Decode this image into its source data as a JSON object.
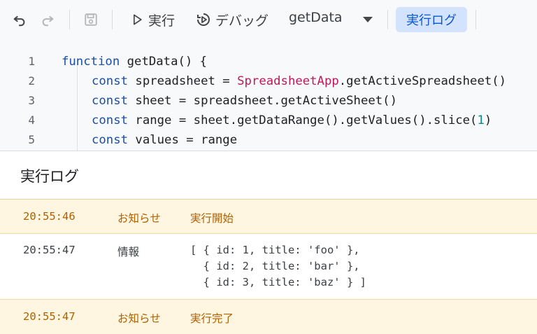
{
  "toolbar": {
    "run_label": "実行",
    "debug_label": "デバッグ",
    "function_select": "getData",
    "log_button": "実行ログ"
  },
  "editor": {
    "lines": [
      {
        "num": "1",
        "parts": [
          {
            "t": "function",
            "c": "kw"
          },
          {
            "t": " getData() {",
            "c": ""
          }
        ]
      },
      {
        "num": "2",
        "parts": [
          {
            "t": "const",
            "c": "kw"
          },
          {
            "t": " spreadsheet = ",
            "c": ""
          },
          {
            "t": "SpreadsheetApp",
            "c": "cls"
          },
          {
            "t": ".getActiveSpreadsheet()",
            "c": ""
          }
        ]
      },
      {
        "num": "3",
        "parts": [
          {
            "t": "const",
            "c": "kw"
          },
          {
            "t": " sheet = spreadsheet.getActiveSheet()",
            "c": ""
          }
        ]
      },
      {
        "num": "4",
        "parts": [
          {
            "t": "const",
            "c": "kw"
          },
          {
            "t": " range = sheet.getDataRange().getValues().slice(",
            "c": ""
          },
          {
            "t": "1",
            "c": "num"
          },
          {
            "t": ")",
            "c": ""
          }
        ]
      },
      {
        "num": "5",
        "parts": [
          {
            "t": "const",
            "c": "kw"
          },
          {
            "t": " values = range",
            "c": ""
          }
        ]
      }
    ]
  },
  "log": {
    "title": "実行ログ",
    "entries": [
      {
        "time": "20:55:46",
        "level": "お知らせ",
        "message": "実行開始"
      },
      {
        "time": "20:55:47",
        "level": "情報",
        "message": "[ { id: 1, title: 'foo' },\n  { id: 2, title: 'bar' },\n  { id: 3, title: 'baz' } ]"
      },
      {
        "time": "20:55:47",
        "level": "お知らせ",
        "message": "実行完了"
      }
    ]
  },
  "colors": {
    "accent": "#0b57d0",
    "notice_bg": "#fef6e0",
    "notice_text": "#b06000"
  }
}
